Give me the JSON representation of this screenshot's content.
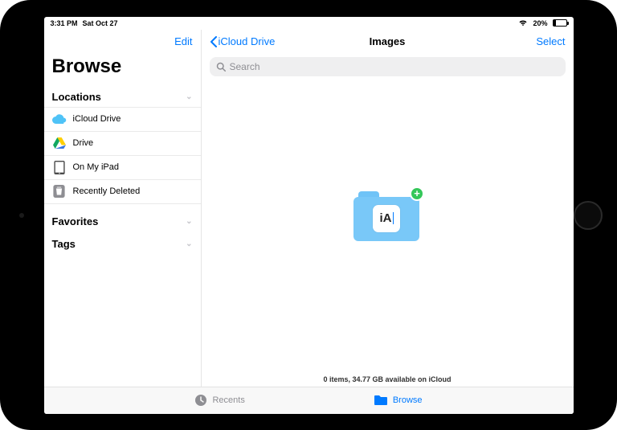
{
  "status": {
    "time": "3:31 PM",
    "date": "Sat Oct 27",
    "battery_pct": "20%"
  },
  "sidebar": {
    "edit": "Edit",
    "title": "Browse",
    "sections": {
      "locations": "Locations",
      "favorites": "Favorites",
      "tags": "Tags"
    },
    "locations": [
      {
        "label": "iCloud Drive"
      },
      {
        "label": "Drive"
      },
      {
        "label": "On My iPad"
      },
      {
        "label": "Recently Deleted"
      }
    ]
  },
  "main": {
    "back": "iCloud Drive",
    "title": "Images",
    "select": "Select",
    "search_placeholder": "Search",
    "drop_app_label": "iA",
    "footer": "0 items, 34.77 GB available on iCloud"
  },
  "bottombar": {
    "recents": "Recents",
    "browse": "Browse"
  }
}
